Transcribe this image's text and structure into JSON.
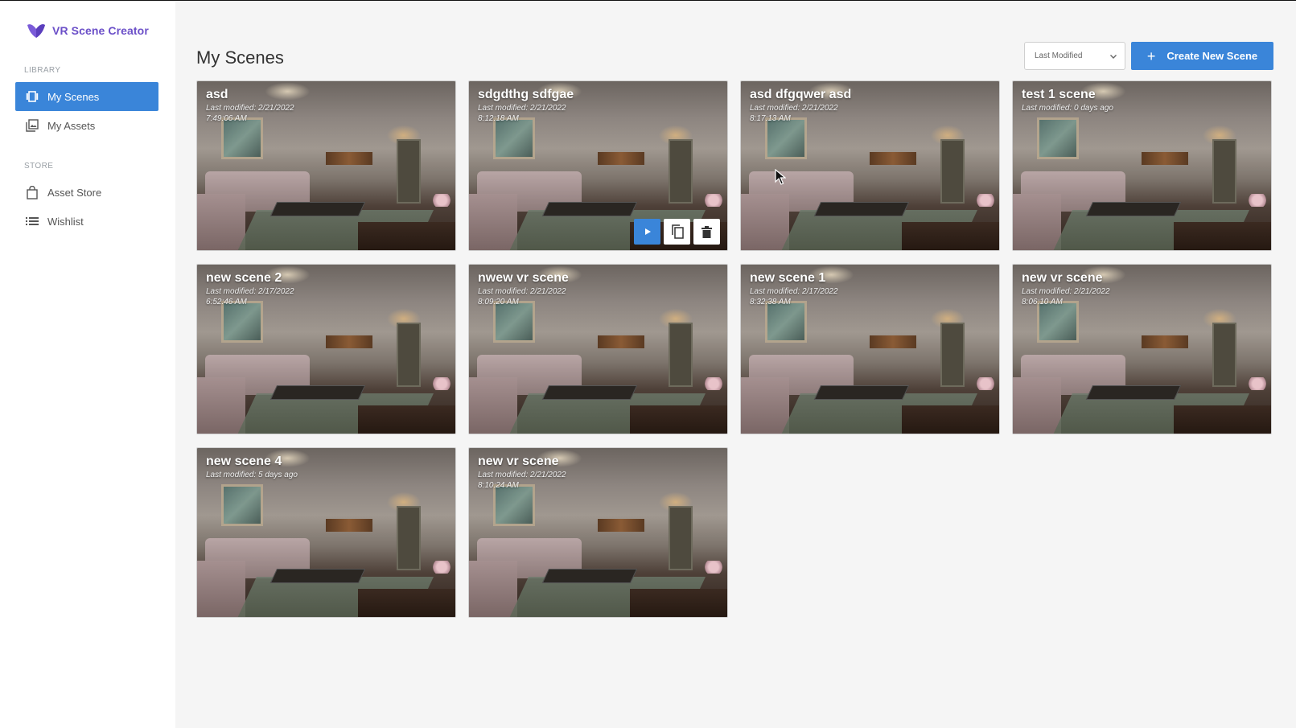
{
  "app": {
    "name": "VR Scene Creator",
    "brand_color": "#6b4fc8",
    "accent_color": "#3a85d9"
  },
  "sidebar": {
    "sections": [
      {
        "label": "LIBRARY",
        "items": [
          {
            "label": "My Scenes",
            "icon": "scenes-icon",
            "active": true
          },
          {
            "label": "My Assets",
            "icon": "assets-icon",
            "active": false
          }
        ]
      },
      {
        "label": "STORE",
        "items": [
          {
            "label": "Asset Store",
            "icon": "shopping-bag-icon",
            "active": false
          },
          {
            "label": "Wishlist",
            "icon": "list-icon",
            "active": false
          }
        ]
      }
    ]
  },
  "header": {
    "title": "My Scenes",
    "sort": {
      "selected": "Last Modified"
    },
    "create_label": "Create New Scene"
  },
  "scenes": [
    {
      "title": "asd",
      "modified_line1": "Last modified: 2/21/2022",
      "modified_line2": "7:49:06 AM"
    },
    {
      "title": "sdgdthg sdfgae",
      "modified_line1": "Last modified: 2/21/2022",
      "modified_line2": "8:12:18 AM",
      "hovered": true
    },
    {
      "title": "asd dfgqwer asd",
      "modified_line1": "Last modified: 2/21/2022",
      "modified_line2": "8:17:13 AM"
    },
    {
      "title": "test 1 scene",
      "modified_line1": "Last modified: 0 days ago",
      "modified_line2": ""
    },
    {
      "title": "new scene 2",
      "modified_line1": "Last modified: 2/17/2022",
      "modified_line2": "6:52:46 AM"
    },
    {
      "title": "nwew vr scene",
      "modified_line1": "Last modified: 2/21/2022",
      "modified_line2": "8:09:20 AM"
    },
    {
      "title": "new scene 1",
      "modified_line1": "Last modified: 2/17/2022",
      "modified_line2": "8:32:38 AM"
    },
    {
      "title": "new vr scene",
      "modified_line1": "Last modified: 2/21/2022",
      "modified_line2": "8:06:10 AM"
    },
    {
      "title": "new scene 4",
      "modified_line1": "Last modified: 5 days ago",
      "modified_line2": ""
    },
    {
      "title": "new vr scene",
      "modified_line1": "Last modified: 2/21/2022",
      "modified_line2": "8:10:24 AM"
    }
  ]
}
